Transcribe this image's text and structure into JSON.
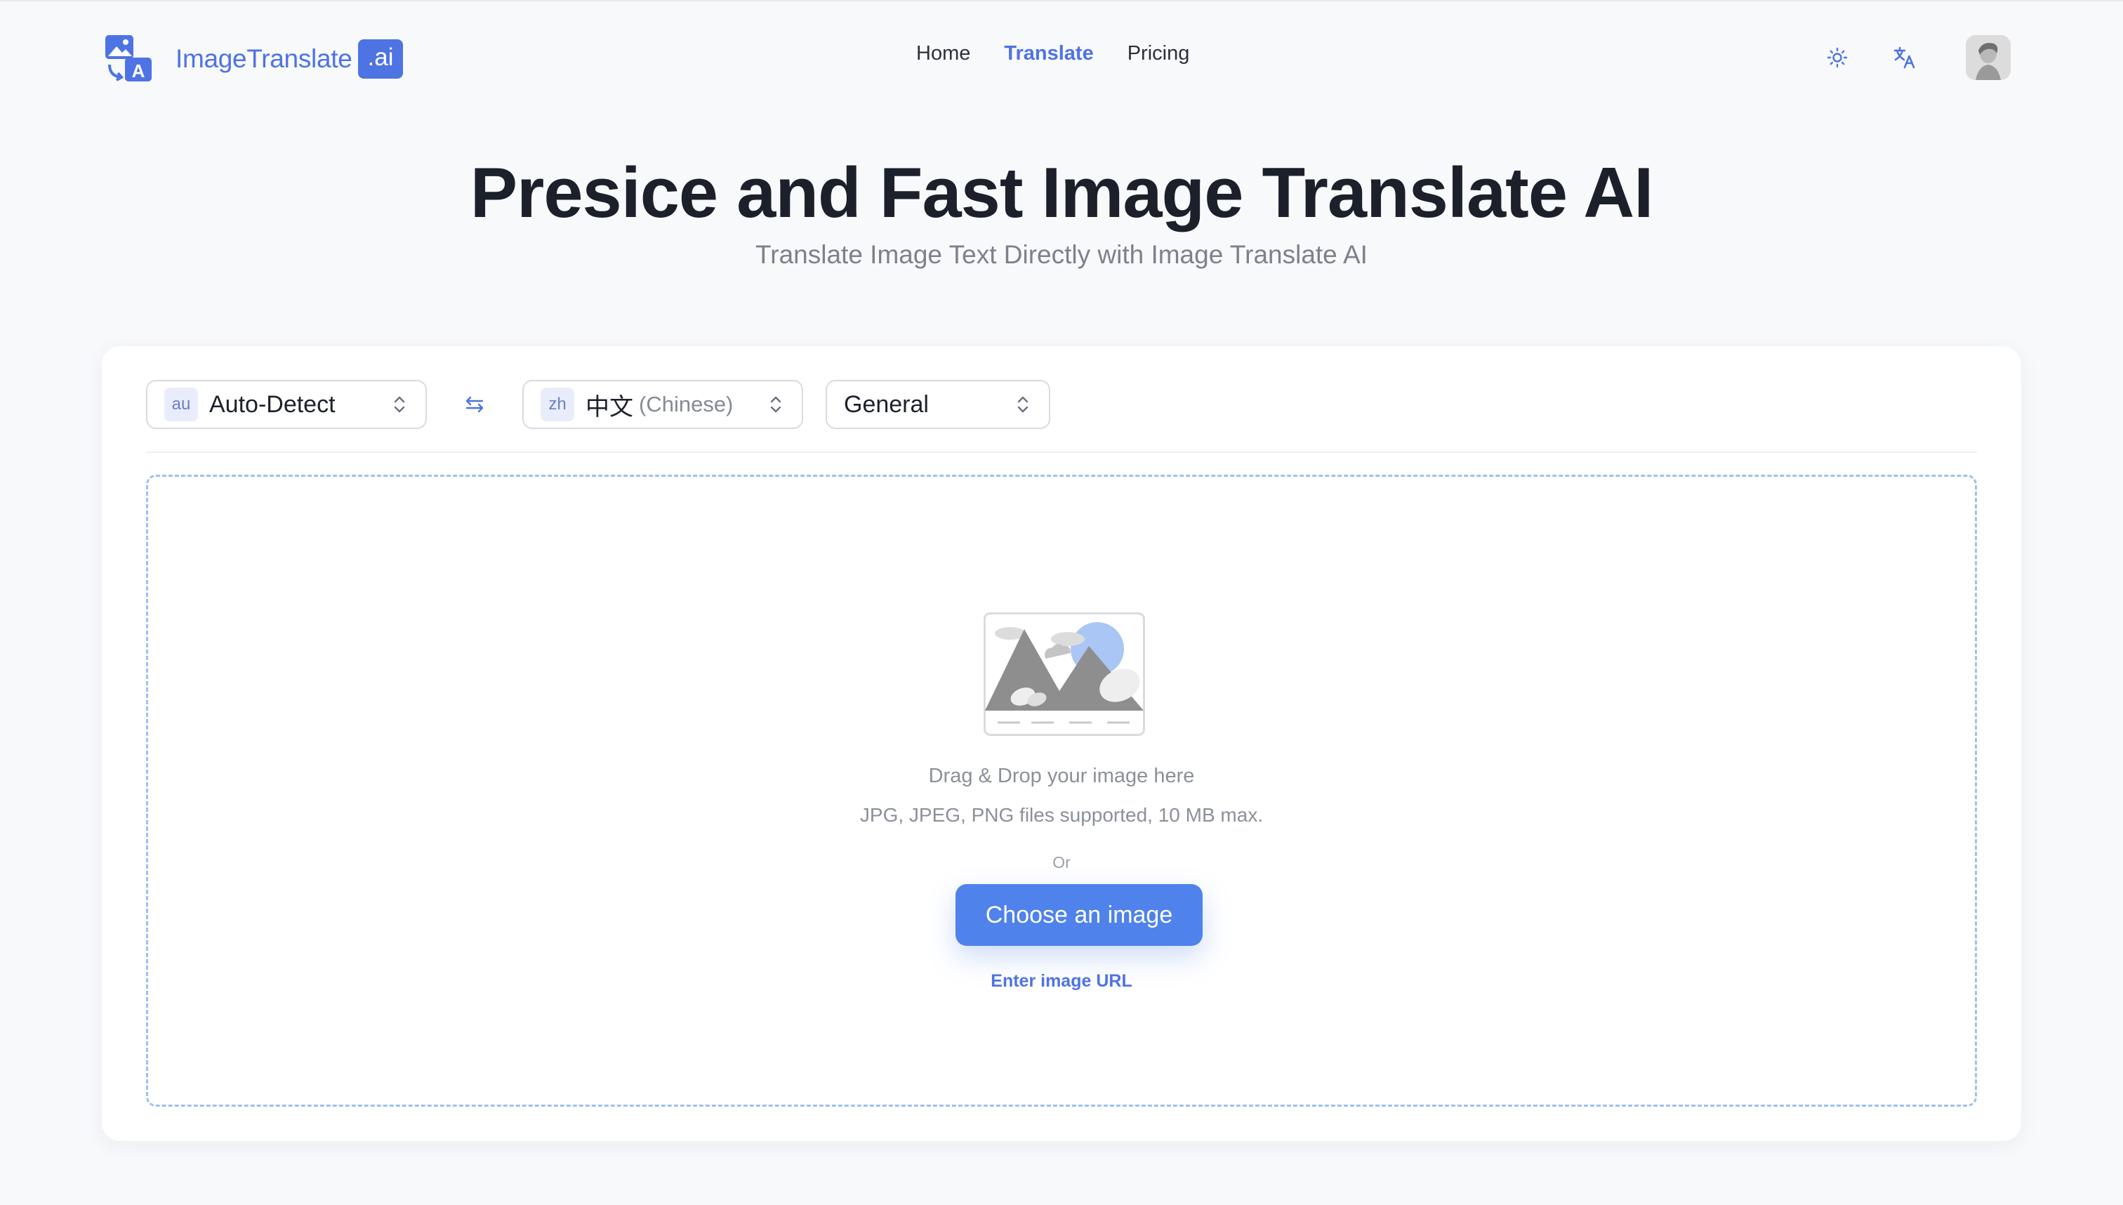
{
  "brand": {
    "name": "ImageTranslate",
    "badge": ".ai"
  },
  "nav": {
    "items": [
      {
        "label": "Home",
        "active": false
      },
      {
        "label": "Translate",
        "active": true
      },
      {
        "label": "Pricing",
        "active": false
      }
    ]
  },
  "header_actions": {
    "theme_icon": "sun-icon",
    "language_icon": "translate-icon",
    "avatar_icon": "user-avatar"
  },
  "hero": {
    "title": "Presice and Fast Image Translate AI",
    "subtitle": "Translate Image Text Directly with Image Translate AI"
  },
  "toolbar": {
    "source_language": {
      "code": "au",
      "label": "Auto-Detect"
    },
    "swap_icon": "swap-arrows-icon",
    "target_language": {
      "code": "zh",
      "label": "中文",
      "sublabel": "(Chinese)"
    },
    "mode": {
      "label": "General"
    }
  },
  "upload": {
    "title": "Drag & Drop your image here",
    "note": "JPG, JPEG, PNG files supported, 10 MB max.",
    "or": "Or",
    "button_label": "Choose an image",
    "url_link": "Enter image URL"
  },
  "colors": {
    "accent": "#4e73e3",
    "button": "#4f82ea",
    "dashed_border": "#9ec0ef",
    "background": "#f8f9fb"
  }
}
